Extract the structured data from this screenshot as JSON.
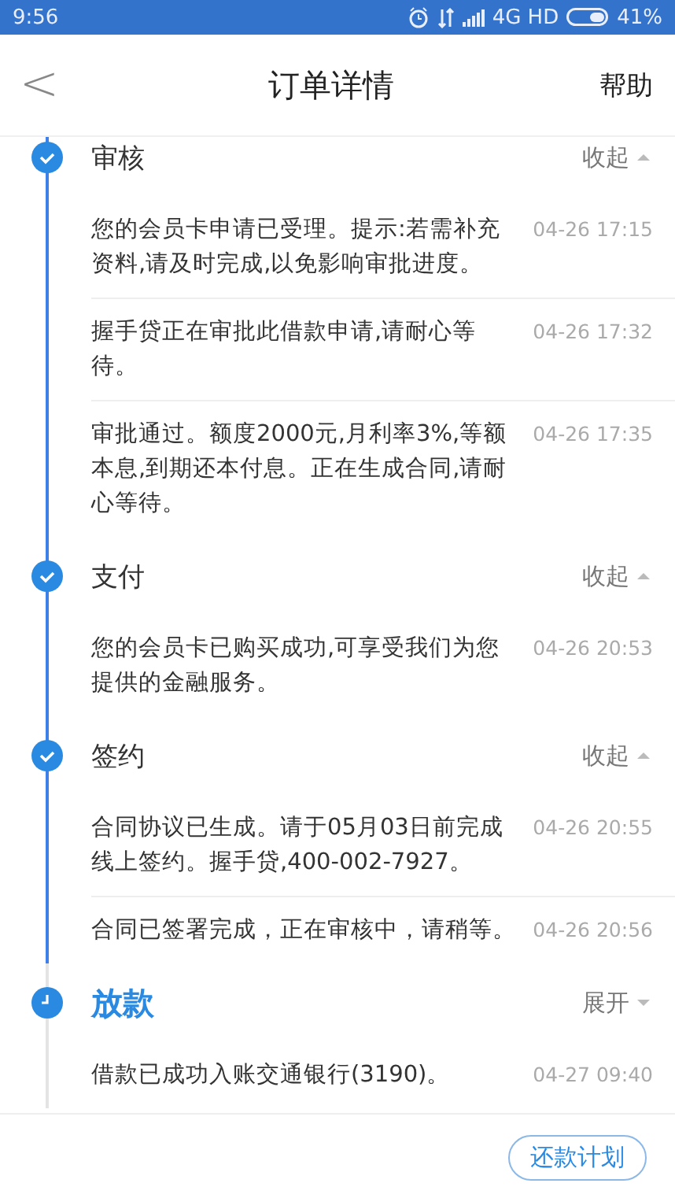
{
  "status_bar": {
    "time": "9:56",
    "network": "4G HD",
    "battery": "41%"
  },
  "header": {
    "back": "<",
    "title": "订单详情",
    "help": "帮助"
  },
  "stages": [
    {
      "title": "审核",
      "kind": "done",
      "expanded": true,
      "toggle": "收起",
      "entries": [
        {
          "text": "您的会员卡申请已受理。提示:若需补充资料,请及时完成,以免影响审批进度。",
          "time": "04-26 17:15"
        },
        {
          "text": "握手贷正在审批此借款申请,请耐心等待。",
          "time": "04-26 17:32"
        },
        {
          "text": "审批通过。额度2000元,月利率3%,等额本息,到期还本付息。正在生成合同,请耐心等待。",
          "time": "04-26 17:35"
        }
      ]
    },
    {
      "title": "支付",
      "kind": "done",
      "expanded": true,
      "toggle": "收起",
      "entries": [
        {
          "text": "您的会员卡已购买成功,可享受我们为您提供的金融服务。",
          "time": "04-26 20:53"
        }
      ]
    },
    {
      "title": "签约",
      "kind": "done",
      "expanded": true,
      "toggle": "收起",
      "entries": [
        {
          "text": "合同协议已生成。请于05月03日前完成线上签约。握手贷,400-002-7927。",
          "time": "04-26 20:55"
        },
        {
          "text": "合同已签署完成，正在审核中，请稍等。",
          "time": "04-26 20:56"
        }
      ]
    },
    {
      "title": "放款",
      "kind": "current",
      "expanded": false,
      "toggle": "展开",
      "entries": [
        {
          "text": "借款已成功入账交通银行(3190)。",
          "time": "04-27 09:40"
        }
      ]
    }
  ],
  "footer": {
    "button": "还款计划"
  }
}
